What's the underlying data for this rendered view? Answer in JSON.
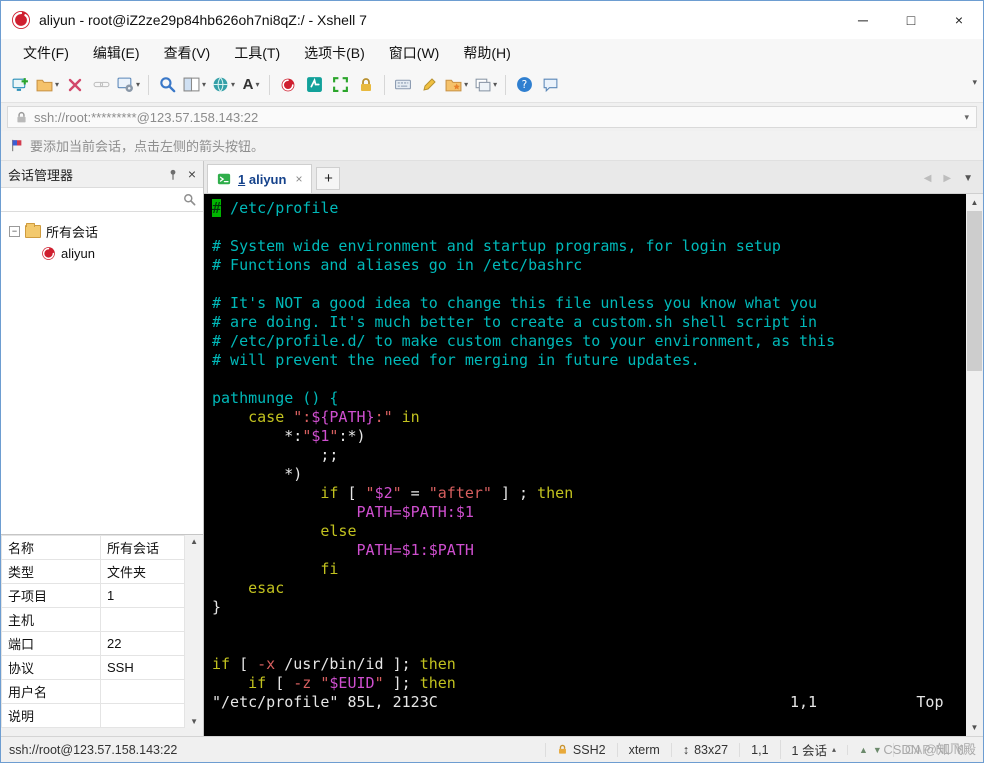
{
  "window": {
    "title": "aliyun - root@iZ2ze29p84hb626oh7ni8qZ:/ - Xshell 7",
    "controls": {
      "minimize": "─",
      "maximize": "□",
      "close": "×"
    }
  },
  "menu": {
    "items": [
      "文件(F)",
      "编辑(E)",
      "查看(V)",
      "工具(T)",
      "选项卡(B)",
      "窗口(W)",
      "帮助(H)"
    ]
  },
  "toolbar": {
    "icons": [
      "new-session",
      "open-session",
      "disconnect",
      "reconnect",
      "session-properties",
      "find",
      "split-window",
      "open-url",
      "font",
      "record",
      "xftp",
      "fullscreen",
      "lock-screen",
      "virtual-keyboard",
      "compose",
      "favorites",
      "window-layout",
      "help",
      "feedback",
      "overflow"
    ]
  },
  "address_bar": {
    "value": "ssh://root:*********@123.57.158.143:22"
  },
  "info_bar": {
    "text": "要添加当前会话，点击左侧的箭头按钮。"
  },
  "session_manager": {
    "title": "会话管理器",
    "tree": {
      "root_label": "所有会话",
      "child_label": "aliyun",
      "expander": "−"
    },
    "properties": [
      {
        "label": "名称",
        "value": "所有会话"
      },
      {
        "label": "类型",
        "value": "文件夹"
      },
      {
        "label": "子项目",
        "value": "1"
      },
      {
        "label": "主机",
        "value": ""
      },
      {
        "label": "端口",
        "value": "22"
      },
      {
        "label": "协议",
        "value": "SSH"
      },
      {
        "label": "用户名",
        "value": ""
      },
      {
        "label": "说明",
        "value": ""
      }
    ]
  },
  "tabs": {
    "active_number": "1",
    "active_name": "aliyun",
    "close": "×",
    "new_tab": "+"
  },
  "terminal": {
    "lines": [
      [
        [
          "cursor",
          "#"
        ],
        [
          "cyan",
          " /etc/profile"
        ]
      ],
      [],
      [
        [
          "cyan",
          "# System wide environment and startup programs, for login setup"
        ]
      ],
      [
        [
          "cyan",
          "# Functions and aliases go in /etc/bashrc"
        ]
      ],
      [],
      [
        [
          "cyan",
          "# It's NOT a good idea to change this file unless you know what you"
        ]
      ],
      [
        [
          "cyan",
          "# are doing. It's much better to create a custom.sh shell script in"
        ]
      ],
      [
        [
          "cyan",
          "# /etc/profile.d/ to make custom changes to your environment, as this"
        ]
      ],
      [
        [
          "cyan",
          "# will prevent the need for merging in future updates."
        ]
      ],
      [],
      [
        [
          "cyan",
          "pathmunge () {"
        ]
      ],
      [
        [
          "fg",
          "    "
        ],
        [
          "yellow",
          "case"
        ],
        [
          "fg",
          " "
        ],
        [
          "red",
          "\":"
        ],
        [
          "magenta",
          "${PATH}"
        ],
        [
          "red",
          ":\""
        ],
        [
          "fg",
          " "
        ],
        [
          "yellow",
          "in"
        ]
      ],
      [
        [
          "fg",
          "        *:"
        ],
        [
          "red",
          "\""
        ],
        [
          "magenta",
          "$1"
        ],
        [
          "red",
          "\""
        ],
        [
          "fg",
          ":*)"
        ]
      ],
      [
        [
          "fg",
          "            ;;"
        ]
      ],
      [
        [
          "fg",
          "        *)"
        ]
      ],
      [
        [
          "fg",
          "            "
        ],
        [
          "yellow",
          "if"
        ],
        [
          "fg",
          " [ "
        ],
        [
          "red",
          "\""
        ],
        [
          "magenta",
          "$2"
        ],
        [
          "red",
          "\""
        ],
        [
          "fg",
          " = "
        ],
        [
          "red",
          "\"after\""
        ],
        [
          "fg",
          " ] ; "
        ],
        [
          "yellow",
          "then"
        ]
      ],
      [
        [
          "fg",
          "                "
        ],
        [
          "magenta",
          "PATH=$PATH:$1"
        ]
      ],
      [
        [
          "fg",
          "            "
        ],
        [
          "yellow",
          "else"
        ]
      ],
      [
        [
          "fg",
          "                "
        ],
        [
          "magenta",
          "PATH=$1:$PATH"
        ]
      ],
      [
        [
          "fg",
          "            "
        ],
        [
          "yellow",
          "fi"
        ]
      ],
      [
        [
          "fg",
          "    "
        ],
        [
          "yellow",
          "esac"
        ]
      ],
      [
        [
          "fg",
          "}"
        ]
      ],
      [],
      [],
      [
        [
          "yellow",
          "if"
        ],
        [
          "fg",
          " [ "
        ],
        [
          "red",
          "-x"
        ],
        [
          "fg",
          " /usr/bin/id ]; "
        ],
        [
          "yellow",
          "then"
        ]
      ],
      [
        [
          "fg",
          "    "
        ],
        [
          "yellow",
          "if"
        ],
        [
          "fg",
          " [ "
        ],
        [
          "red",
          "-z"
        ],
        [
          "fg",
          " "
        ],
        [
          "red",
          "\""
        ],
        [
          "magenta",
          "$EUID"
        ],
        [
          "red",
          "\""
        ],
        [
          "fg",
          " ]; "
        ],
        [
          "yellow",
          "then"
        ]
      ],
      [
        [
          "fg",
          "\"/etc/profile\" 85L, 2123C                                       1,1           Top"
        ]
      ]
    ],
    "colors": {
      "background": "#000000",
      "comment_cyan": "#00b9b9",
      "keyword_yellow": "#c2c21f",
      "variable_magenta": "#cf4fcf",
      "string_red": "#d75f5f",
      "foreground": "#e6e6e6",
      "cursor_green": "#00b400"
    }
  },
  "status_bar": {
    "address": "ssh://root@123.57.158.143:22",
    "protocol": "SSH2",
    "term_type": "xterm",
    "size_icon": "↕",
    "size": "83x27",
    "cursor": "1,1",
    "sessions": "1 会话",
    "caps": "CAP",
    "num": "NUM",
    "watermark": "CSDN @知飞殿"
  }
}
